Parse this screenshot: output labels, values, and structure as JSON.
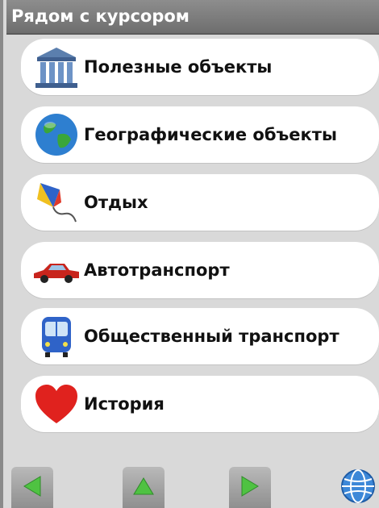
{
  "header": {
    "title": "Рядом с курсором"
  },
  "menu": {
    "items": [
      {
        "label": "Полезные объекты",
        "icon": "museum-building-icon"
      },
      {
        "label": "Географические объекты",
        "icon": "earth-globe-icon"
      },
      {
        "label": "Отдых",
        "icon": "kite-icon"
      },
      {
        "label": "Автотранспорт",
        "icon": "red-car-icon"
      },
      {
        "label": "Общественный транспорт",
        "icon": "bus-icon"
      },
      {
        "label": "История",
        "icon": "heart-icon"
      }
    ]
  },
  "toolbar": {
    "buttons": [
      {
        "icon": "arrow-left-icon"
      },
      {
        "icon": "arrow-up-icon"
      },
      {
        "icon": "arrow-right-icon"
      },
      {
        "icon": "globe-icon"
      }
    ]
  },
  "colors": {
    "title_bar": "#7d7d7d",
    "background": "#d9d9d9",
    "item_background": "#ffffff",
    "arrow_green": "#4fc242"
  }
}
